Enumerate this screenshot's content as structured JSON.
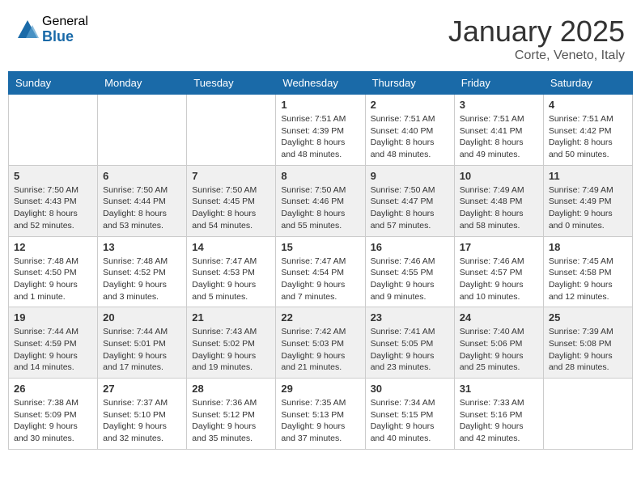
{
  "logo": {
    "general": "General",
    "blue": "Blue"
  },
  "title": {
    "month_year": "January 2025",
    "location": "Corte, Veneto, Italy"
  },
  "days_of_week": [
    "Sunday",
    "Monday",
    "Tuesday",
    "Wednesday",
    "Thursday",
    "Friday",
    "Saturday"
  ],
  "weeks": [
    [
      {
        "day": "",
        "sunrise": "",
        "sunset": "",
        "daylight": ""
      },
      {
        "day": "",
        "sunrise": "",
        "sunset": "",
        "daylight": ""
      },
      {
        "day": "",
        "sunrise": "",
        "sunset": "",
        "daylight": ""
      },
      {
        "day": "1",
        "sunrise": "Sunrise: 7:51 AM",
        "sunset": "Sunset: 4:39 PM",
        "daylight": "Daylight: 8 hours and 48 minutes."
      },
      {
        "day": "2",
        "sunrise": "Sunrise: 7:51 AM",
        "sunset": "Sunset: 4:40 PM",
        "daylight": "Daylight: 8 hours and 48 minutes."
      },
      {
        "day": "3",
        "sunrise": "Sunrise: 7:51 AM",
        "sunset": "Sunset: 4:41 PM",
        "daylight": "Daylight: 8 hours and 49 minutes."
      },
      {
        "day": "4",
        "sunrise": "Sunrise: 7:51 AM",
        "sunset": "Sunset: 4:42 PM",
        "daylight": "Daylight: 8 hours and 50 minutes."
      }
    ],
    [
      {
        "day": "5",
        "sunrise": "Sunrise: 7:50 AM",
        "sunset": "Sunset: 4:43 PM",
        "daylight": "Daylight: 8 hours and 52 minutes."
      },
      {
        "day": "6",
        "sunrise": "Sunrise: 7:50 AM",
        "sunset": "Sunset: 4:44 PM",
        "daylight": "Daylight: 8 hours and 53 minutes."
      },
      {
        "day": "7",
        "sunrise": "Sunrise: 7:50 AM",
        "sunset": "Sunset: 4:45 PM",
        "daylight": "Daylight: 8 hours and 54 minutes."
      },
      {
        "day": "8",
        "sunrise": "Sunrise: 7:50 AM",
        "sunset": "Sunset: 4:46 PM",
        "daylight": "Daylight: 8 hours and 55 minutes."
      },
      {
        "day": "9",
        "sunrise": "Sunrise: 7:50 AM",
        "sunset": "Sunset: 4:47 PM",
        "daylight": "Daylight: 8 hours and 57 minutes."
      },
      {
        "day": "10",
        "sunrise": "Sunrise: 7:49 AM",
        "sunset": "Sunset: 4:48 PM",
        "daylight": "Daylight: 8 hours and 58 minutes."
      },
      {
        "day": "11",
        "sunrise": "Sunrise: 7:49 AM",
        "sunset": "Sunset: 4:49 PM",
        "daylight": "Daylight: 9 hours and 0 minutes."
      }
    ],
    [
      {
        "day": "12",
        "sunrise": "Sunrise: 7:48 AM",
        "sunset": "Sunset: 4:50 PM",
        "daylight": "Daylight: 9 hours and 1 minute."
      },
      {
        "day": "13",
        "sunrise": "Sunrise: 7:48 AM",
        "sunset": "Sunset: 4:52 PM",
        "daylight": "Daylight: 9 hours and 3 minutes."
      },
      {
        "day": "14",
        "sunrise": "Sunrise: 7:47 AM",
        "sunset": "Sunset: 4:53 PM",
        "daylight": "Daylight: 9 hours and 5 minutes."
      },
      {
        "day": "15",
        "sunrise": "Sunrise: 7:47 AM",
        "sunset": "Sunset: 4:54 PM",
        "daylight": "Daylight: 9 hours and 7 minutes."
      },
      {
        "day": "16",
        "sunrise": "Sunrise: 7:46 AM",
        "sunset": "Sunset: 4:55 PM",
        "daylight": "Daylight: 9 hours and 9 minutes."
      },
      {
        "day": "17",
        "sunrise": "Sunrise: 7:46 AM",
        "sunset": "Sunset: 4:57 PM",
        "daylight": "Daylight: 9 hours and 10 minutes."
      },
      {
        "day": "18",
        "sunrise": "Sunrise: 7:45 AM",
        "sunset": "Sunset: 4:58 PM",
        "daylight": "Daylight: 9 hours and 12 minutes."
      }
    ],
    [
      {
        "day": "19",
        "sunrise": "Sunrise: 7:44 AM",
        "sunset": "Sunset: 4:59 PM",
        "daylight": "Daylight: 9 hours and 14 minutes."
      },
      {
        "day": "20",
        "sunrise": "Sunrise: 7:44 AM",
        "sunset": "Sunset: 5:01 PM",
        "daylight": "Daylight: 9 hours and 17 minutes."
      },
      {
        "day": "21",
        "sunrise": "Sunrise: 7:43 AM",
        "sunset": "Sunset: 5:02 PM",
        "daylight": "Daylight: 9 hours and 19 minutes."
      },
      {
        "day": "22",
        "sunrise": "Sunrise: 7:42 AM",
        "sunset": "Sunset: 5:03 PM",
        "daylight": "Daylight: 9 hours and 21 minutes."
      },
      {
        "day": "23",
        "sunrise": "Sunrise: 7:41 AM",
        "sunset": "Sunset: 5:05 PM",
        "daylight": "Daylight: 9 hours and 23 minutes."
      },
      {
        "day": "24",
        "sunrise": "Sunrise: 7:40 AM",
        "sunset": "Sunset: 5:06 PM",
        "daylight": "Daylight: 9 hours and 25 minutes."
      },
      {
        "day": "25",
        "sunrise": "Sunrise: 7:39 AM",
        "sunset": "Sunset: 5:08 PM",
        "daylight": "Daylight: 9 hours and 28 minutes."
      }
    ],
    [
      {
        "day": "26",
        "sunrise": "Sunrise: 7:38 AM",
        "sunset": "Sunset: 5:09 PM",
        "daylight": "Daylight: 9 hours and 30 minutes."
      },
      {
        "day": "27",
        "sunrise": "Sunrise: 7:37 AM",
        "sunset": "Sunset: 5:10 PM",
        "daylight": "Daylight: 9 hours and 32 minutes."
      },
      {
        "day": "28",
        "sunrise": "Sunrise: 7:36 AM",
        "sunset": "Sunset: 5:12 PM",
        "daylight": "Daylight: 9 hours and 35 minutes."
      },
      {
        "day": "29",
        "sunrise": "Sunrise: 7:35 AM",
        "sunset": "Sunset: 5:13 PM",
        "daylight": "Daylight: 9 hours and 37 minutes."
      },
      {
        "day": "30",
        "sunrise": "Sunrise: 7:34 AM",
        "sunset": "Sunset: 5:15 PM",
        "daylight": "Daylight: 9 hours and 40 minutes."
      },
      {
        "day": "31",
        "sunrise": "Sunrise: 7:33 AM",
        "sunset": "Sunset: 5:16 PM",
        "daylight": "Daylight: 9 hours and 42 minutes."
      },
      {
        "day": "",
        "sunrise": "",
        "sunset": "",
        "daylight": ""
      }
    ]
  ]
}
